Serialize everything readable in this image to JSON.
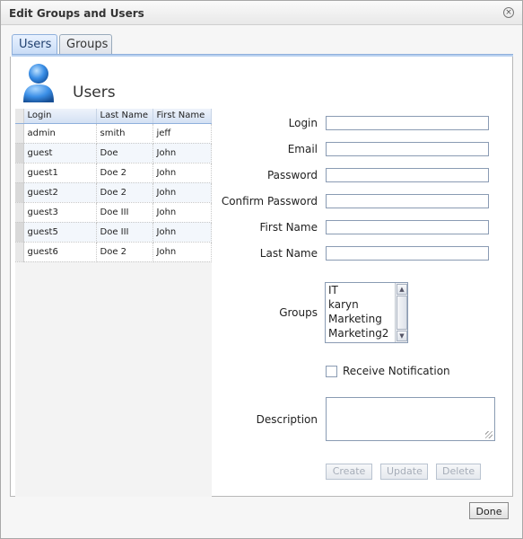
{
  "window": {
    "title": "Edit Groups and Users",
    "close_glyph": "×"
  },
  "tabs": [
    {
      "label": "Users",
      "active": true
    },
    {
      "label": "Groups",
      "active": false
    }
  ],
  "panel": {
    "heading": "Users",
    "icon": "user-avatar-icon"
  },
  "grid": {
    "columns": [
      "Login",
      "Last Name",
      "First Name"
    ],
    "rows": [
      [
        "admin",
        "smith",
        "jeff"
      ],
      [
        "guest",
        "Doe",
        "John"
      ],
      [
        "guest1",
        "Doe 2",
        "John"
      ],
      [
        "guest2",
        "Doe 2",
        "John"
      ],
      [
        "guest3",
        "Doe III",
        "John"
      ],
      [
        "guest5",
        "Doe III",
        "John"
      ],
      [
        "guest6",
        "Doe 2",
        "John"
      ]
    ]
  },
  "form": {
    "login_label": "Login",
    "email_label": "Email",
    "password_label": "Password",
    "confirm_password_label": "Confirm Password",
    "first_name_label": "First Name",
    "last_name_label": "Last Name",
    "groups_label": "Groups",
    "groups_options": [
      "IT",
      "karyn",
      "Marketing",
      "Marketing2"
    ],
    "receive_notification_label": "Receive Notification",
    "receive_notification_checked": false,
    "description_label": "Description",
    "login_value": "",
    "email_value": "",
    "password_value": "",
    "confirm_password_value": "",
    "first_name_value": "",
    "last_name_value": "",
    "description_value": ""
  },
  "actions": {
    "create_label": "Create",
    "update_label": "Update",
    "delete_label": "Delete",
    "done_label": "Done"
  },
  "colors": {
    "accent": "#8fb0dc",
    "tab_active": "#c9dcf6",
    "avatar": "#3a8ee6",
    "disabled_text": "#a6adb8"
  }
}
